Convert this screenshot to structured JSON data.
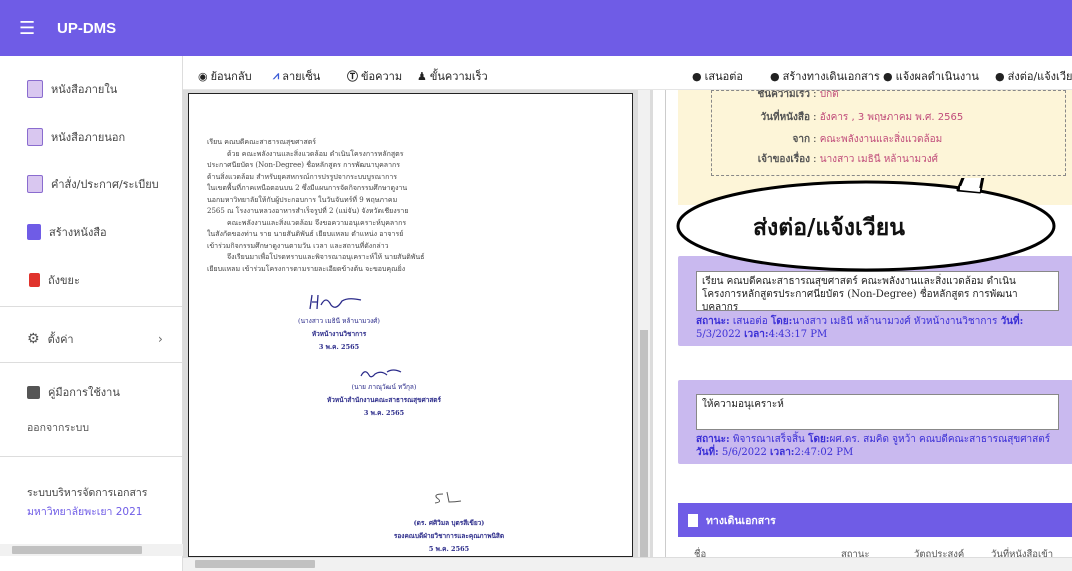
{
  "app": {
    "title": "UP-DMS",
    "menu_icon": "hamburger-icon"
  },
  "sidebar": {
    "items": [
      {
        "label": "หนังสือภายใน",
        "icon": "inbox-folder-icon"
      },
      {
        "label": "หนังสือภายนอก",
        "icon": "outbox-folder-icon"
      },
      {
        "label": "คำสั่ง/ประกาศ/ระเบียบ",
        "icon": "order-folder-icon"
      },
      {
        "label": "สร้างหนังสือ",
        "icon": "create-document-icon"
      },
      {
        "label": "ถังขยะ",
        "icon": "trash-icon"
      },
      {
        "label": "ตั้งค่า",
        "icon": "gear-icon"
      },
      {
        "label": "คู่มือการใช้งาน",
        "icon": "manual-icon"
      }
    ],
    "logout": "ออกจากระบบ",
    "footer_line1": "ระบบบริหารจัดการเอกสาร",
    "footer_line2": "มหาวิทยาลัยพะเยา 2021"
  },
  "toolbar": {
    "back": "ย้อนกลับ",
    "signature": "ลายเซ็น",
    "text": "ข้อความ",
    "express": "ขั้นความเร็ว",
    "propose": "เสนอต่อ",
    "create_route": "สร้างทางเดินเอกสาร",
    "report": "แจ้งผลดำเนินงาน",
    "forward": "ส่งต่อ/แจ้งเวียน"
  },
  "document": {
    "salutation": "เรียน คณบดีคณะสาธารณสุขศาสตร์",
    "body": [
      "ด้วย คณะพลังงานและสิ่งแวดล้อม ดำเนินโครงการหลักสูตร",
      "ประกาศนียบัตร (Non-Degree) ชื่อหลักสูตร การพัฒนาบุคลากร",
      "ด้านสิ่งแวดล้อม สำหรับยุคสหกรณ์การปรรูปจากระบบบูรณาการ",
      "ในเขตพื้นที่ภาคเหนือตอนบน 2 ซึ่งมีแผนการจัดกิจกรรมศึกษาดูงาน",
      "นอกมหาวิทยาลัยให้กับผู้ประกอบการ ในวันจันทร์ที่ 9 พฤษภาคม",
      "2565 ณ โรงงานหลวงอาหารสำเร็จรูปที่ 2 (แม่จัน) จังหวัดเชียงราย",
      "คณะพลังงานและสิ่งแวดล้อม จึงขอความอนุเคราะห์บุคลากร",
      "ในสังกัดของท่าน ราย นายสันติพันธ์ เยียบแหลม ตำแหน่ง อาจารย์",
      "เข้าร่วมกิจกรรมศึกษาดูงานตามวัน เวลา และสถานที่ดังกล่าว",
      "จึงเรียนมาเพื่อโปรดทราบและพิจารณาอนุเคราะห์ให้ นายสันติพันธ์",
      "เยียบแหลม เข้าร่วมโครงการตามรายละเอียดข้างต้น จะขอบคุณยิ่ง"
    ],
    "sig1_name": "(นางสาว เมธินี หล้านามวงศ์)",
    "sig1_title": "หัวหน้างานวิชาการ",
    "sig1_date": "3 พ.ค. 2565",
    "sig2_name": "(นาย ภาณุวัฒน์ ทวีกุล)",
    "sig2_title": "หัวหน้าสำนักงานคณะสาธารณสุขศาสตร์",
    "sig2_date": "3 พ.ค. 2565",
    "sig3_name": "(ดร. ศศิวิมล บุตรสีเขียว)",
    "sig3_title": "รองคณบดีฝ่ายวิชาการและคุณภาพนิสิต",
    "sig3_date": "5 พ.ค. 2565"
  },
  "info": {
    "urgency_label": "ชั้นความเร็ว",
    "urgency_value": "ปกติ",
    "date_label": "วันที่หนังสือ",
    "date_value": "อังคาร , 3 พฤษภาคม พ.ศ. 2565",
    "from_label": "จาก",
    "from_value": "คณะพลังงานและสิ่งแวดล้อม",
    "owner_label": "เจ้าของเรื่อง",
    "owner_value": "นางสาว เมธินี หล้านามวงศ์"
  },
  "callout": {
    "text": "ส่งต่อ/แจ้งเวียน"
  },
  "comments": [
    {
      "text": "เรียน คณบดีคณะสาธารณสุขศาสตร์ คณะพลังงานและสิ่งแวดล้อม ดำเนินโครงการหลักสูตรประกาศนียบัตร (Non-Degree) ชื่อหลักสูตร การพัฒนาบุคลากร",
      "status_label": "สถานะ:",
      "status": "เสนอต่อ",
      "by_label": "โดย:",
      "by": "นางสาว เมธินี หล้านามวงศ์ หัวหน้างานวิชาการ",
      "date_label": "วันที่:",
      "date": "5/3/2022",
      "time_label": "เวลา:",
      "time": "4:43:17 PM"
    },
    {
      "text": "ให้ความอนุเคราะห์",
      "status_label": "สถานะ:",
      "status": "พิจารณาเสร็จสิ้น",
      "by_label": "โดย:",
      "by": "ผศ.ดร. สมคิด จูหว้า คณบดีคณะสาธารณสุขศาสตร์",
      "date_label": "วันที่:",
      "date": "5/6/2022",
      "time_label": "เวลา:",
      "time": "2:47:02 PM"
    }
  ],
  "route": {
    "title": "ทางเดินเอกสาร",
    "columns": [
      "ชื่อ",
      "สถานะ",
      "วัตถุประสงค์",
      "วันที่หนังสือเข้า"
    ]
  },
  "colors": {
    "topbar": "#6f5ce6",
    "comment_card": "#c9b9ef",
    "info_card": "#fdf5d8",
    "value_text": "#c04b7a"
  }
}
